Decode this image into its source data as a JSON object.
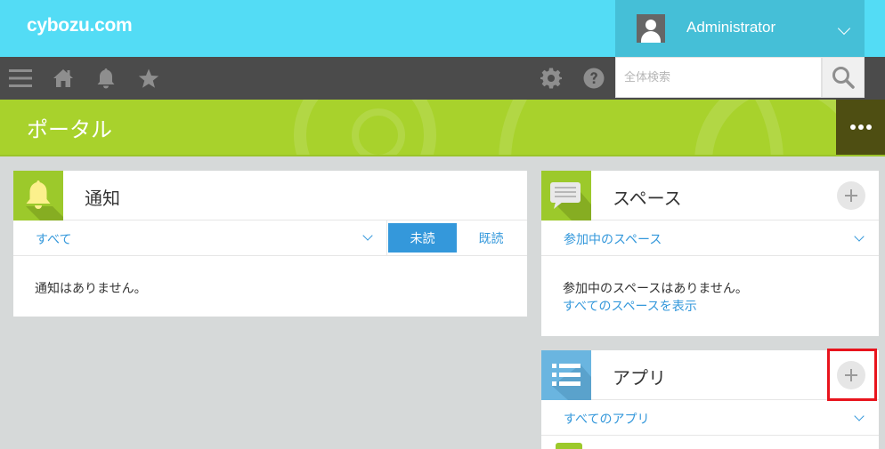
{
  "header": {
    "logo": "cybozu.com",
    "user_name": "Administrator"
  },
  "nav": {
    "icons": [
      "menu-icon",
      "home-icon",
      "bell-icon",
      "star-icon",
      "gear-icon",
      "help-icon"
    ],
    "search_placeholder": "全体検索"
  },
  "page": {
    "title": "ポータル"
  },
  "notifications": {
    "title": "通知",
    "filter": "すべて",
    "tab_unread": "未読",
    "tab_read": "既読",
    "empty_message": "通知はありません。"
  },
  "spaces": {
    "title": "スペース",
    "filter": "参加中のスペース",
    "empty_message": "参加中のスペースはありません。",
    "show_all_link": "すべてのスペースを表示"
  },
  "apps": {
    "title": "アプリ",
    "filter": "すべてのアプリ"
  },
  "colors": {
    "header_bg": "#53dcf5",
    "user_box_bg": "#45bfd7",
    "nav_bg": "#4b4b4b",
    "banner_bg": "#a8d22c",
    "accent_blue": "#3498db",
    "highlight_red": "#e8141d"
  }
}
